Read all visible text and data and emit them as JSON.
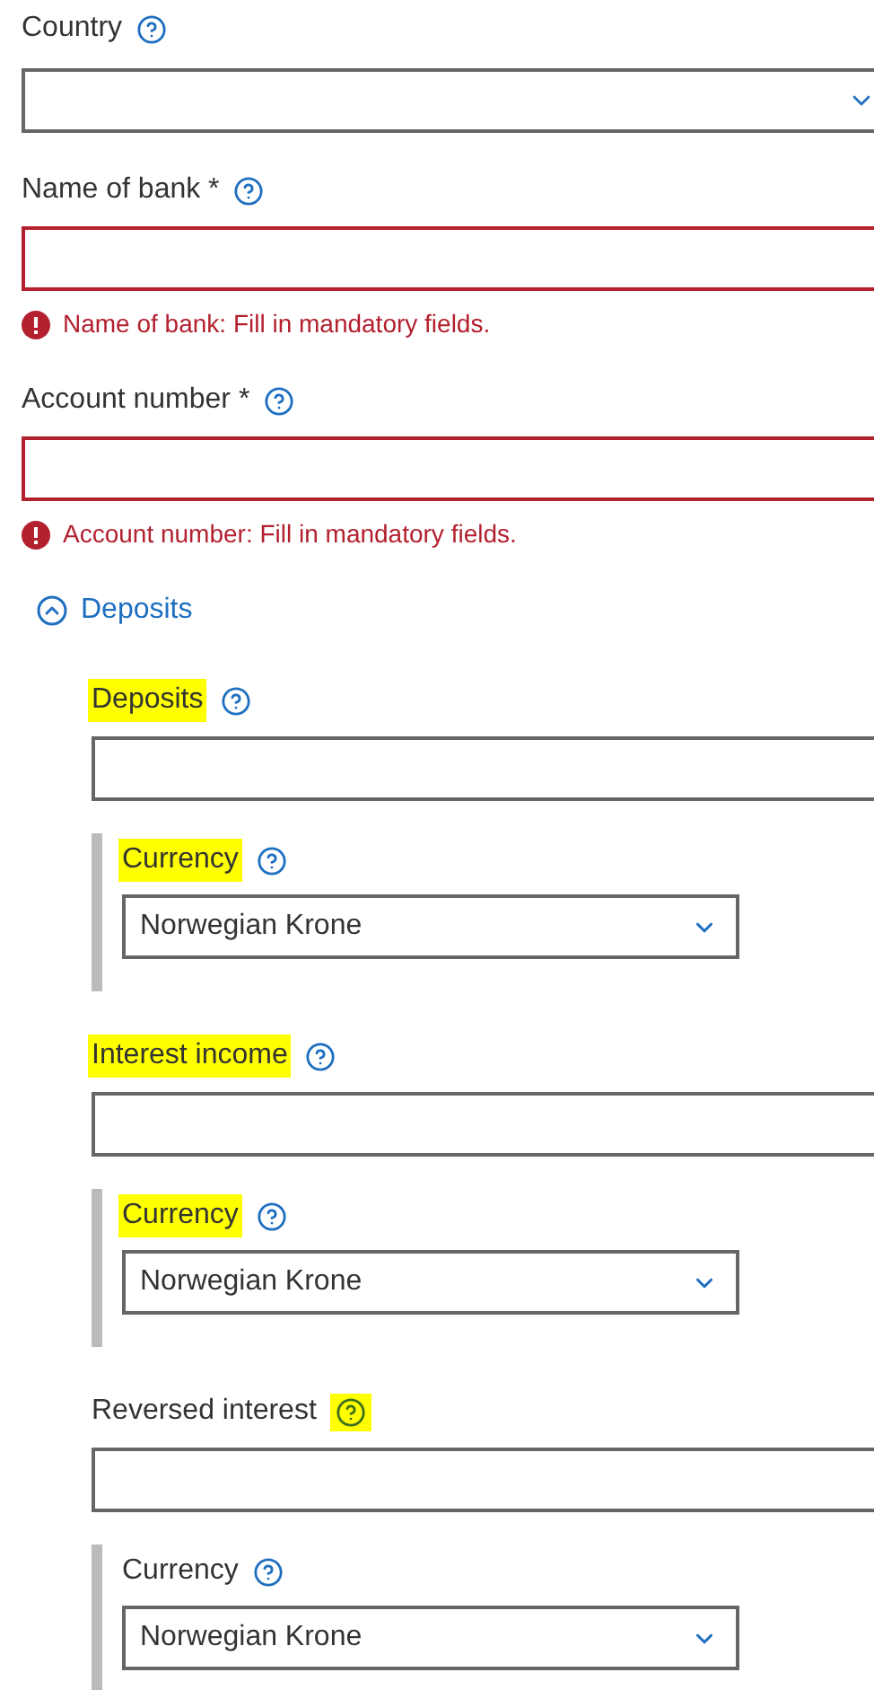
{
  "fields": [
    {
      "kind": "select",
      "label": "Country",
      "invalid": false
    },
    {
      "kind": "text",
      "label": "Name of bank *",
      "invalid": true,
      "error": "Name of bank: Fill in mandatory fields."
    },
    {
      "kind": "text",
      "label": "Account number *",
      "invalid": true,
      "error": "Account number: Fill in mandatory fields."
    }
  ],
  "section": {
    "title": "Deposits",
    "expanded": true,
    "fields": [
      {
        "label": "Deposits",
        "label_highlighted": true,
        "help_highlighted": false,
        "currency": {
          "label": "Currency",
          "label_highlighted": true,
          "value": "Norwegian Krone"
        }
      },
      {
        "label": "Interest income",
        "label_highlighted": true,
        "help_highlighted": false,
        "currency": {
          "label": "Currency",
          "label_highlighted": true,
          "value": "Norwegian Krone"
        }
      },
      {
        "label": "Reversed interest",
        "label_highlighted": false,
        "help_highlighted": true,
        "currency": {
          "label": "Currency",
          "label_highlighted": false,
          "value": "Norwegian Krone"
        }
      }
    ]
  }
}
